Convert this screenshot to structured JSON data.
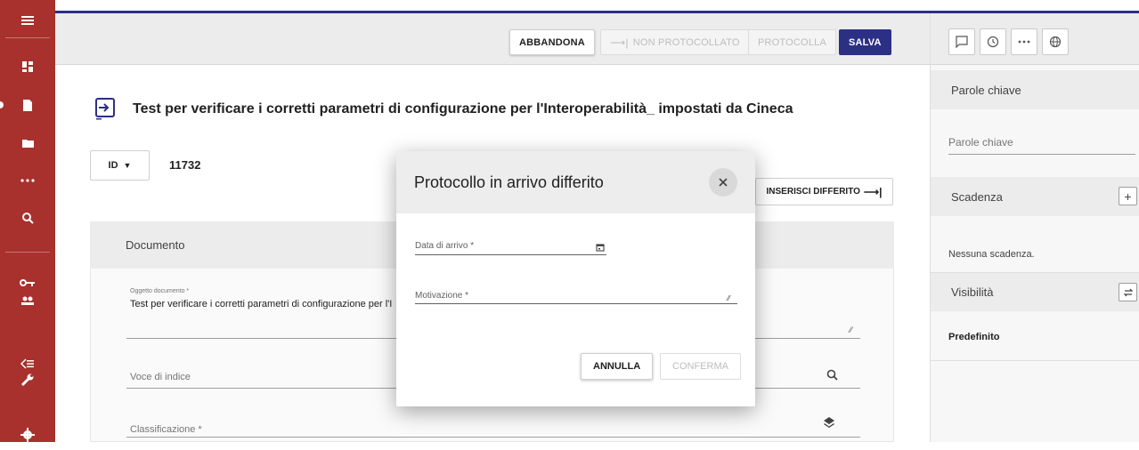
{
  "rail": {
    "icons": [
      "menu-icon",
      "dashboard-icon",
      "document-icon",
      "folder-icon",
      "more-icon",
      "search-icon",
      "key-icon",
      "people-icon",
      "list-icon",
      "wrench-icon",
      "gear-icon"
    ]
  },
  "toolbar": {
    "abbandona_label": "ABBANDONA",
    "non_protocollato_label": "NON PROTOCOLLATO",
    "protocolla_label": "PROTOCOLLA",
    "salva_label": "SALVA"
  },
  "document": {
    "title": "Test per verificare i corretti parametri di configurazione per l'Interoperabilità_ impostati da Cineca",
    "id_selector_label": "ID",
    "id_value": "11732",
    "inserisci_differito_label": "INSERISCI DIFFERITO"
  },
  "section": {
    "title": "Documento",
    "oggetto_label": "Oggetto documento *",
    "oggetto_value": "Test per verificare i corretti parametri di configurazione  per l'I",
    "voce_indice_label": "Voce di indice",
    "classificazione_label": "Classificazione *"
  },
  "right_panel": {
    "parole_chiave_header": "Parole chiave",
    "parole_chiave_placeholder": "Parole chiave",
    "scadenza_header": "Scadenza",
    "scadenza_empty": "Nessuna scadenza.",
    "visibilita_header": "Visibilità",
    "visibilita_value": "Predefinito"
  },
  "dialog": {
    "title": "Protocollo in arrivo differito",
    "data_arrivo_label": "Data di arrivo *",
    "motivazione_label": "Motivazione *",
    "annulla_label": "ANNULLA",
    "conferma_label": "CONFERMA"
  },
  "colors": {
    "rail": "#a8302d",
    "primary": "#2c3085",
    "panel_header": "#ececec"
  }
}
